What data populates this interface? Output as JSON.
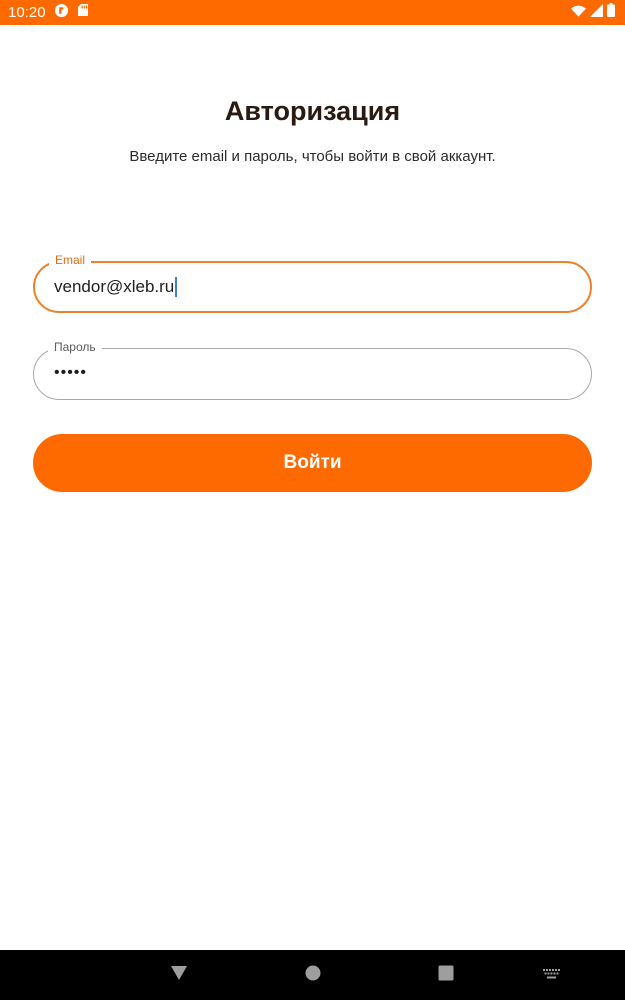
{
  "status_bar": {
    "time": "10:20",
    "background": "#FF6A00",
    "left_icons": [
      "notification-app-icon",
      "sd-card-icon"
    ],
    "right_icons": [
      "wifi-icon",
      "signal-icon",
      "battery-icon"
    ]
  },
  "login": {
    "title": "Авторизация",
    "subtitle": "Введите email и пароль, чтобы войти в свой аккаунт.",
    "email": {
      "label": "Email",
      "value": "vendor@xleb.ru",
      "focused": true
    },
    "password": {
      "label": "Пароль",
      "value": "•••••"
    },
    "submit_label": "Войти"
  },
  "colors": {
    "accent": "#FF6A00",
    "focused_border": "#F0802A",
    "idle_border": "#a9a9a9",
    "title": "#2a1a12"
  },
  "nav_bar": {
    "icons": [
      "back-icon",
      "home-icon",
      "recent-apps-icon",
      "keyboard-icon"
    ]
  }
}
